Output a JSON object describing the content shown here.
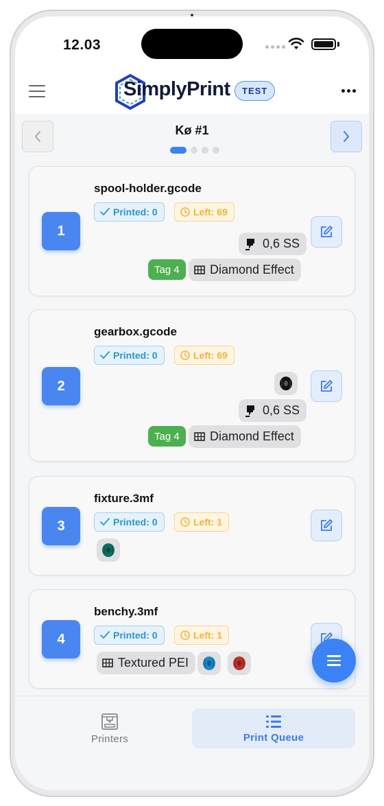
{
  "status_bar": {
    "time": "12.03"
  },
  "header": {
    "brand": "SimplyPrint",
    "badge": "TEST"
  },
  "queue": {
    "title": "Kø #1"
  },
  "items": [
    {
      "number": "1",
      "file": "spool-holder.gcode",
      "printed": "Printed: 0",
      "left": "Left: 69",
      "nozzle": "0,6 SS",
      "tag": "Tag 4",
      "bed": "Diamond Effect"
    },
    {
      "number": "2",
      "file": "gearbox.gcode",
      "printed": "Printed: 0",
      "left": "Left: 69",
      "filament_colors": [
        "#111111"
      ],
      "nozzle": "0,6 SS",
      "tag": "Tag 4",
      "bed": "Diamond Effect"
    },
    {
      "number": "3",
      "file": "fixture.3mf",
      "printed": "Printed: 0",
      "left": "Left: 1",
      "filament_colors": [
        "#0d6e5e"
      ]
    },
    {
      "number": "4",
      "file": "benchy.3mf",
      "printed": "Printed: 0",
      "left": "Left: 1",
      "bed": "Textured PEI",
      "filament_colors": [
        "#1b86c8",
        "#c0302a"
      ]
    }
  ],
  "tabs": {
    "printers": "Printers",
    "print_queue": "Print Queue"
  },
  "colors": {
    "accent": "#3b82f6",
    "printed": "#2b95cf",
    "left": "#efb33b",
    "tag": "#4caf50"
  },
  "icons": {
    "menu": "hamburger-icon",
    "more": "more-dots-icon",
    "prev": "chevron-left-icon",
    "next": "chevron-right-icon",
    "check": "check-icon",
    "clock": "clock-icon",
    "edit": "edit-icon",
    "nozzle": "nozzle-icon",
    "bed": "bed-grid-icon",
    "spool": "filament-spool-icon",
    "printer": "printer-icon",
    "queue": "list-icon"
  }
}
